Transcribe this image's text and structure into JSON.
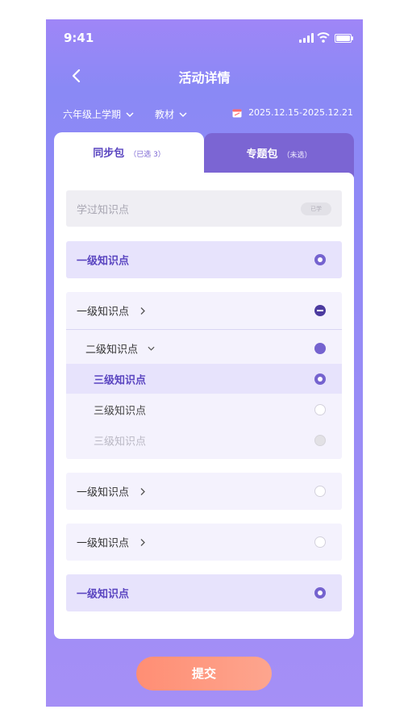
{
  "status": {
    "time": "9:41"
  },
  "nav": {
    "title": "活动详情"
  },
  "filters": {
    "grade": "六年级上学期",
    "material": "教材",
    "date_range": "2025.12.15-2025.12.21"
  },
  "tabs": [
    {
      "label": "同步包",
      "sub": "（已选 3）"
    },
    {
      "label": "专题包",
      "sub": "（未选）"
    }
  ],
  "learned": {
    "label": "学过知识点",
    "badge": "已学"
  },
  "rows": {
    "r1": "一级知识点",
    "r2": "一级知识点",
    "r2_child": "二级知识点",
    "l3a": "三级知识点",
    "l3b": "三级知识点",
    "l3c": "三级知识点",
    "r3": "一级知识点",
    "r4": "一级知识点",
    "r5": "一级知识点"
  },
  "submit": "提交",
  "colors": {
    "accent": "#7563cf",
    "tab_active_bg": "#7b65d3",
    "submit_start": "#ff8e74",
    "submit_end": "#fda58e"
  }
}
